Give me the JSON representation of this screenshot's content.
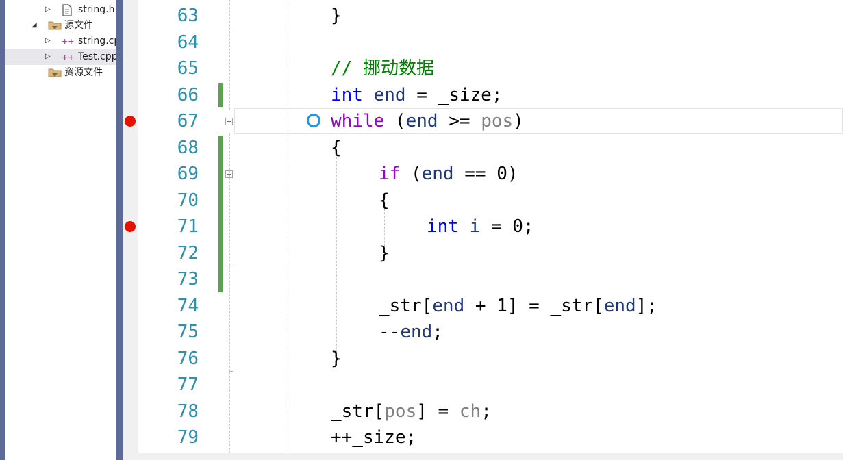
{
  "solution_explorer": {
    "items": [
      {
        "label": "string.h",
        "indent": 2,
        "arrow": "▷",
        "icon": "header-file-icon",
        "selected": false
      },
      {
        "label": "源文件",
        "indent": 1,
        "arrow": "◢",
        "icon": "folder-icon",
        "selected": false
      },
      {
        "label": "string.cpp",
        "indent": 2,
        "arrow": "▷",
        "icon": "cpp-file-icon",
        "selected": false
      },
      {
        "label": "Test.cpp",
        "indent": 2,
        "arrow": "▷",
        "icon": "cpp-file-icon",
        "selected": true
      },
      {
        "label": "资源文件",
        "indent": 1,
        "arrow": "",
        "icon": "folder-icon",
        "selected": false
      }
    ]
  },
  "editor": {
    "breakpoint_lines": [
      67,
      71
    ],
    "current_line": 67,
    "changed_line_ranges": [
      [
        66,
        66
      ],
      [
        68,
        73
      ]
    ],
    "lines": [
      {
        "num": "63",
        "indent": 0,
        "tokens": [
          {
            "t": "}",
            "c": "p"
          }
        ]
      },
      {
        "num": "64",
        "indent": 0,
        "tokens": []
      },
      {
        "num": "65",
        "indent": 0,
        "tokens": [
          {
            "t": "// 挪动数据",
            "c": "cm"
          }
        ]
      },
      {
        "num": "66",
        "indent": 0,
        "tokens": [
          {
            "t": "int",
            "c": "kw"
          },
          {
            "t": " ",
            "c": "p"
          },
          {
            "t": "end",
            "c": "var"
          },
          {
            "t": " = ",
            "c": "p"
          },
          {
            "t": "_size",
            "c": "p"
          },
          {
            "t": ";",
            "c": "p"
          }
        ]
      },
      {
        "num": "67",
        "indent": 0,
        "tokens": [
          {
            "t": "while",
            "c": "kwc"
          },
          {
            "t": " (",
            "c": "p"
          },
          {
            "t": "end",
            "c": "var"
          },
          {
            "t": " >= ",
            "c": "p"
          },
          {
            "t": "pos",
            "c": "par"
          },
          {
            "t": ")",
            "c": "p"
          }
        ]
      },
      {
        "num": "68",
        "indent": 0,
        "tokens": [
          {
            "t": "{",
            "c": "p"
          }
        ]
      },
      {
        "num": "69",
        "indent": 1,
        "tokens": [
          {
            "t": "if",
            "c": "kwc"
          },
          {
            "t": " (",
            "c": "p"
          },
          {
            "t": "end",
            "c": "var"
          },
          {
            "t": " == 0)",
            "c": "p"
          }
        ]
      },
      {
        "num": "70",
        "indent": 1,
        "tokens": [
          {
            "t": "{",
            "c": "p"
          }
        ]
      },
      {
        "num": "71",
        "indent": 2,
        "tokens": [
          {
            "t": "int",
            "c": "kw"
          },
          {
            "t": " ",
            "c": "p"
          },
          {
            "t": "i",
            "c": "var"
          },
          {
            "t": " = 0;",
            "c": "p"
          }
        ]
      },
      {
        "num": "72",
        "indent": 1,
        "tokens": [
          {
            "t": "}",
            "c": "p"
          }
        ]
      },
      {
        "num": "73",
        "indent": 0,
        "tokens": []
      },
      {
        "num": "74",
        "indent": 1,
        "tokens": [
          {
            "t": "_str[",
            "c": "p"
          },
          {
            "t": "end",
            "c": "var"
          },
          {
            "t": " + 1] = _str[",
            "c": "p"
          },
          {
            "t": "end",
            "c": "var"
          },
          {
            "t": "];",
            "c": "p"
          }
        ]
      },
      {
        "num": "75",
        "indent": 1,
        "tokens": [
          {
            "t": "--",
            "c": "p"
          },
          {
            "t": "end",
            "c": "var"
          },
          {
            "t": ";",
            "c": "p"
          }
        ]
      },
      {
        "num": "76",
        "indent": 0,
        "tokens": [
          {
            "t": "}",
            "c": "p"
          }
        ]
      },
      {
        "num": "77",
        "indent": 0,
        "tokens": []
      },
      {
        "num": "78",
        "indent": 0,
        "tokens": [
          {
            "t": "_str[",
            "c": "p"
          },
          {
            "t": "pos",
            "c": "par"
          },
          {
            "t": "] = ",
            "c": "p"
          },
          {
            "t": "ch",
            "c": "par"
          },
          {
            "t": ";",
            "c": "p"
          }
        ]
      },
      {
        "num": "79",
        "indent": 0,
        "tokens": [
          {
            "t": "++_size;",
            "c": "p"
          }
        ]
      }
    ]
  },
  "colors": {
    "keyword": "#0000ff",
    "control_keyword": "#8f08c4",
    "local_variable": "#1f377f",
    "parameter": "#808080",
    "comment": "#008000",
    "line_number": "#2b91af",
    "breakpoint": "#e51400",
    "changed_bar": "#57a64a"
  }
}
